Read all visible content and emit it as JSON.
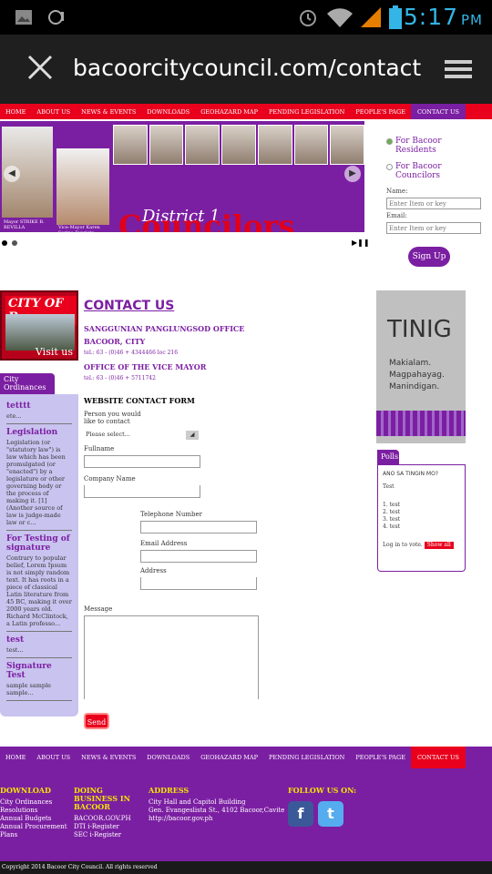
{
  "status_bar": {
    "time": "5:17",
    "ampm": "PM"
  },
  "browser": {
    "url": "bacoorcitycouncil.com/contact"
  },
  "nav": {
    "items": [
      "HOME",
      "ABOUT US",
      "NEWS & EVENTS",
      "DOWNLOADS",
      "GEOHAZARD MAP",
      "PENDING LEGISLATION",
      "PEOPLE'S PAGE",
      "CONTACT US"
    ],
    "active_index": 7
  },
  "banner": {
    "mayor_caption": "Mayor STRIKE B. REVILLA",
    "vice_mayor_caption": "Vice-Mayor Karen Sarino-Evaristo",
    "district": "District 1",
    "title": "Councilors"
  },
  "signup": {
    "option1": "For Bacoor Residents",
    "option2": "For Bacoor Councilors",
    "name_label": "Name:",
    "name_placeholder": "Enter Item or key",
    "email_label": "Email:",
    "email_placeholder": "Enter Item or key",
    "button": "Sign Up"
  },
  "logo": {
    "title": "CITY OF Bacoor",
    "visit": "Visit us"
  },
  "ordinances": {
    "tab": "City Ordinances",
    "items": [
      {
        "title": "tetttt",
        "text": "ete..."
      },
      {
        "title": "Legislation",
        "text": "Legislation (or \"statutory law\") is law which has been promulgated (or \"enacted\") by a legislature or other governing body or the process of making it. [1] (Another source of law is judge-made law or c..."
      },
      {
        "title": "For Testing of signature",
        "text": "Contrary to popular belief, Lorem Ipsum is not simply random text. It has roots in a piece of classical Latin literature from 45 BC, making it over 2000 years old. Richard McClintock, a Latin professo..."
      },
      {
        "title": "test",
        "text": "test..."
      },
      {
        "title": "Signature Test",
        "text": "sample sample sample..."
      }
    ]
  },
  "contact": {
    "heading": "CONTACT US",
    "office1": "SANGGUNIAN PANGLUNGSOD OFFICE",
    "office1_city": "BACOOR, CITY",
    "office1_tel": "tel.: 63 - (0)46 + 4344466 loc 216",
    "office2": "OFFICE OF THE VICE MAYOR",
    "office2_tel": "tel.: 63 - (0)46 + 5711742",
    "form_title": "WEBSITE CONTACT FORM",
    "person_label": "Person you would like to contact",
    "person_value": "Please select...",
    "fullname_label": "Fullname",
    "company_label": "Company Name",
    "telephone_label": "Telephone Number",
    "email_label": "Email Address",
    "address_label": "Address",
    "message_label": "Message",
    "send": "Send"
  },
  "ad": {
    "title": "TINIG",
    "line1": "Makialam.",
    "line2": "Magpahayag.",
    "line3": "Manindigan."
  },
  "polls": {
    "tab": "Polls",
    "question": "ANO SA TINGIN MO?",
    "sub": "Test",
    "options": [
      "1. test",
      "2. test",
      "3. test",
      "4. test"
    ],
    "login": "Log in to vote.",
    "show": "Show all"
  },
  "footer": {
    "download": {
      "title": "DOWNLOAD",
      "links": [
        "City Ordinances",
        "Resolutions",
        "Annual Budgets",
        "Annual Procurement Plans"
      ]
    },
    "business": {
      "title": "DOING BUSINESS IN BACOOR",
      "links": [
        "BACOOR.GOV.PH",
        "DTI i-Register",
        "SEC i-Register"
      ]
    },
    "address": {
      "title": "ADDRESS",
      "lines": [
        "City Hall and Capitol Building",
        "Gen. Evangeslista St., 4102 Bacoor,Cavite",
        "http://bacoor.gov.ph"
      ]
    },
    "follow": {
      "title": "FOLLOW US ON:"
    },
    "copyright": "Copyright 2014 Bacoor City Council. All rights reserved"
  }
}
